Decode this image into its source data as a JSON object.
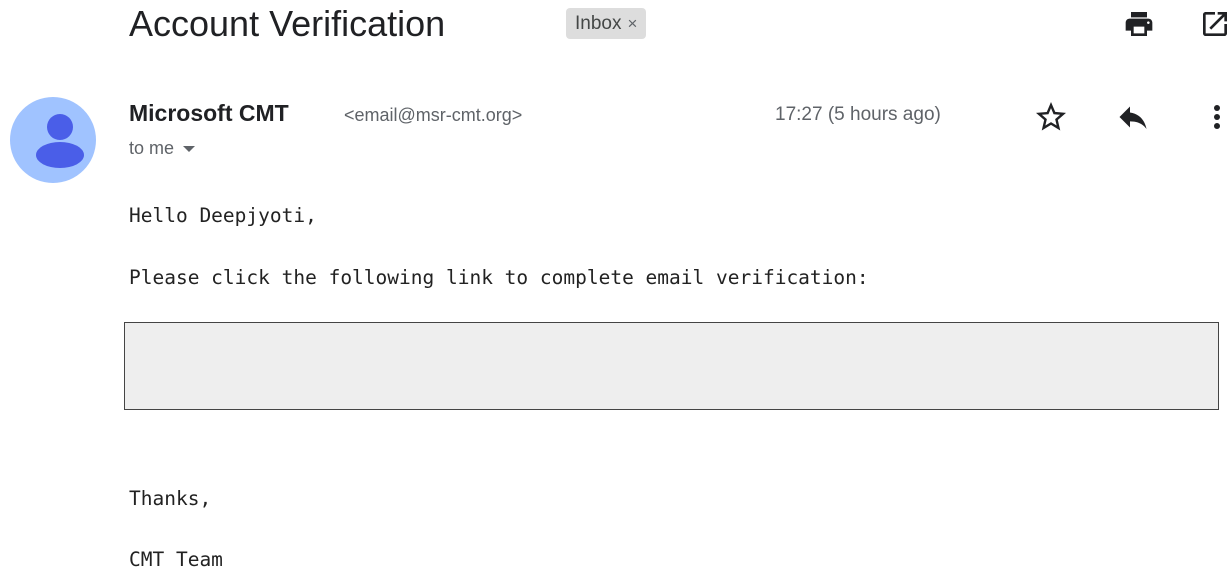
{
  "message": {
    "subject": "Account Verification",
    "label": "Inbox",
    "label_remove": "×"
  },
  "toolbar": {
    "icons": [
      "print-icon",
      "open-in-new-window-icon"
    ]
  },
  "sender": {
    "name": "Microsoft CMT",
    "email": "<email@msr-cmt.org>",
    "recipient": "to me",
    "timestamp": "17:27 (5 hours ago)",
    "avatar_color": "#a0c3ff",
    "avatar_figure_color": "#4a5ee8"
  },
  "actions": {
    "icons": [
      "star-icon",
      "reply-icon",
      "more-vert-icon"
    ]
  },
  "body": {
    "greeting": "Hello Deepjyoti,",
    "instruction": "Please click the following link to complete email verification:",
    "closing": "Thanks,",
    "signature": "CMT Team"
  }
}
